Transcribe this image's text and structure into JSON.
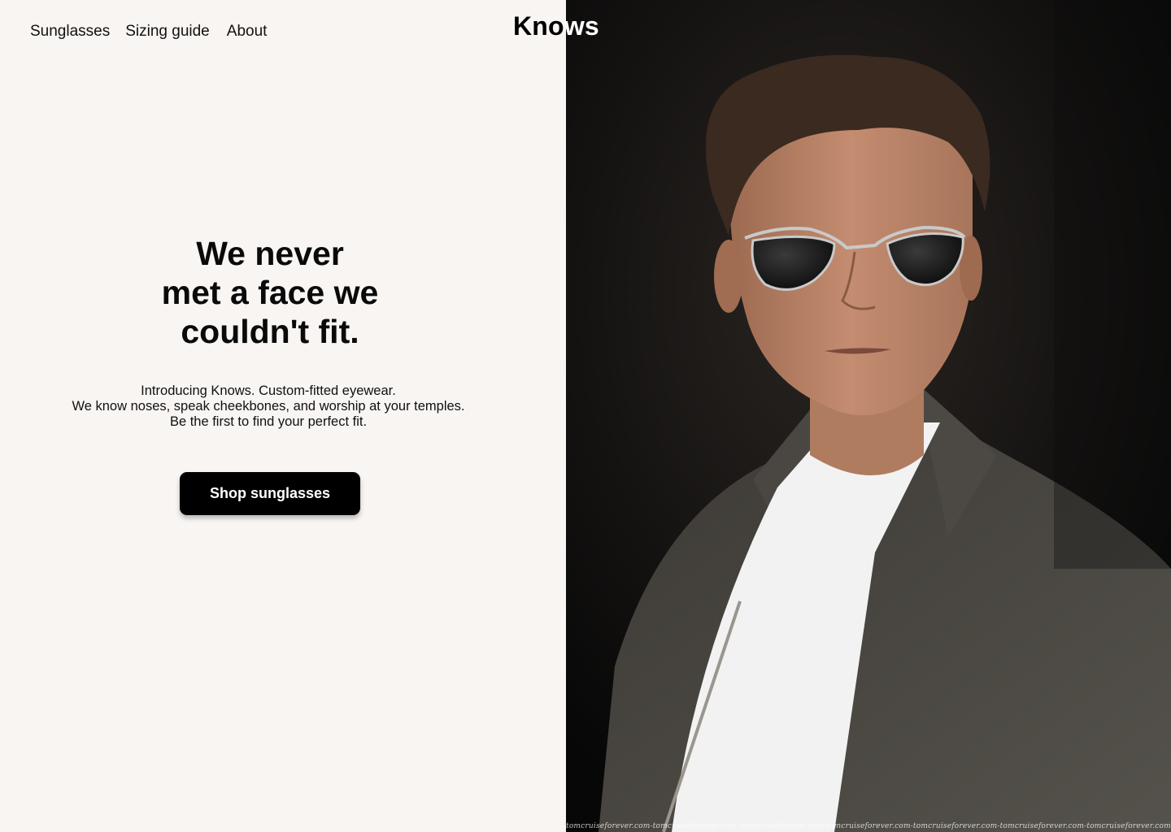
{
  "nav": {
    "items": [
      {
        "label": "Sunglasses"
      },
      {
        "label": "Sizing guide"
      },
      {
        "label": "About"
      }
    ]
  },
  "brand": {
    "logo_dark_part": "Kno",
    "logo_light_part": "ws"
  },
  "hero": {
    "headline_lines": [
      "We never",
      "met a face we",
      "couldn't fit."
    ],
    "subtext_lines": [
      "Introducing Knows. Custom-fitted eyewear.",
      "We know noses, speak cheekbones, and worship at your temples.",
      "Be the first to find your perfect fit."
    ],
    "cta_label": "Shop sunglasses"
  },
  "photo": {
    "subject": "man-in-aviator-sunglasses-photo",
    "watermark_text": "tomcruiseforever.com-tomcruiseforever.com-tomcruiseforever.com-tomcruiseforever.com-tomcruiseforever.com-tomcruiseforever.com-tomcruiseforever.com-tomcruiseforever.com-tomcru"
  },
  "colors": {
    "page_background": "#f8f5f3",
    "text": "#111111",
    "button_bg": "#000000",
    "button_text": "#ffffff",
    "photo_background": "#0a0a0a"
  }
}
